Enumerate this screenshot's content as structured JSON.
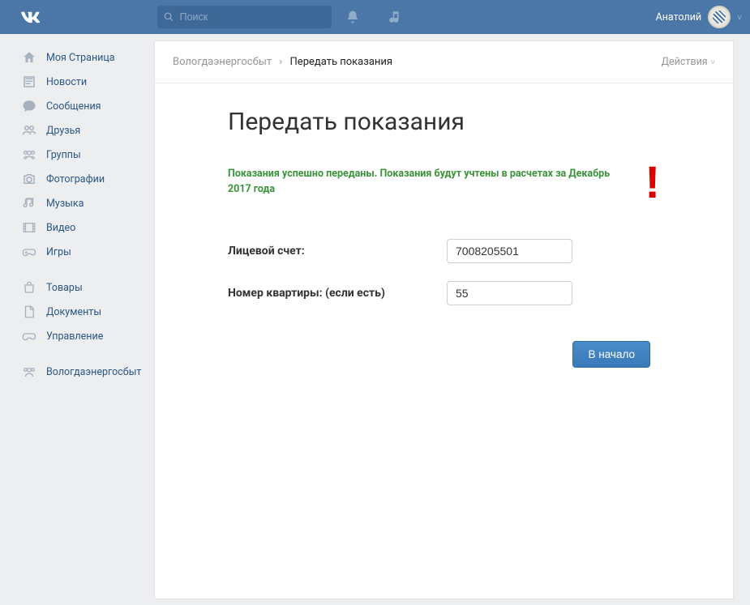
{
  "topbar": {
    "search_placeholder": "Поиск",
    "username": "Анатолий"
  },
  "sidebar": {
    "group1": [
      {
        "icon": "home",
        "label": "Моя Страница"
      },
      {
        "icon": "news",
        "label": "Новости"
      },
      {
        "icon": "msg",
        "label": "Сообщения"
      },
      {
        "icon": "friends",
        "label": "Друзья"
      },
      {
        "icon": "groups",
        "label": "Группы"
      },
      {
        "icon": "photo",
        "label": "Фотографии"
      },
      {
        "icon": "music",
        "label": "Музыка"
      },
      {
        "icon": "video",
        "label": "Видео"
      },
      {
        "icon": "games",
        "label": "Игры"
      }
    ],
    "group2": [
      {
        "icon": "market",
        "label": "Товары"
      },
      {
        "icon": "docs",
        "label": "Документы"
      },
      {
        "icon": "admin",
        "label": "Управление"
      }
    ],
    "group3": [
      {
        "icon": "comm",
        "label": "Вологдаэнергосбыт"
      }
    ]
  },
  "breadcrumb": {
    "parent": "Вологдаэнергосбыт",
    "sep": "›",
    "current": "Передать показания"
  },
  "main": {
    "actions_label": "Действия",
    "title": "Передать показания",
    "success_msg": "Показания успешно переданы. Показания будут учтены в расчетах за Декабрь 2017 года",
    "account_label": "Лицевой счет:",
    "account_value": "7008205501",
    "apt_label": "Номер квартиры: (если есть)",
    "apt_value": "55",
    "back_button": "В начало"
  }
}
